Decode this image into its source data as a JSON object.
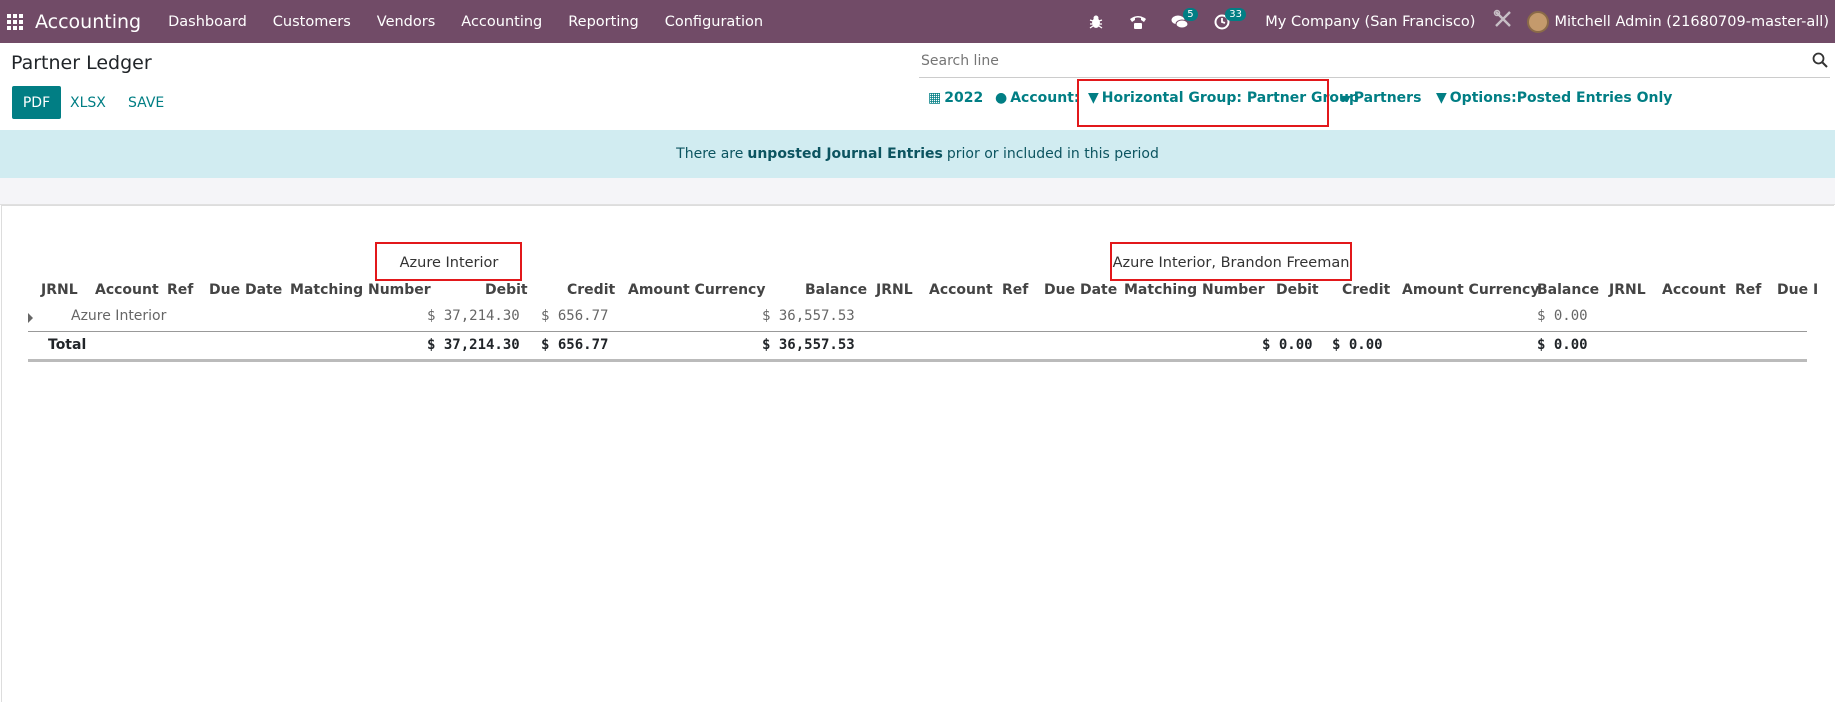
{
  "navbar": {
    "app_name": "Accounting",
    "menu": [
      "Dashboard",
      "Customers",
      "Vendors",
      "Accounting",
      "Reporting",
      "Configuration"
    ],
    "messages_badge": "5",
    "activities_badge": "33",
    "company": "My Company (San Francisco)",
    "user": "Mitchell Admin (21680709-master-all)",
    "bg_color": "#714B67"
  },
  "page": {
    "title": "Partner Ledger",
    "buttons": {
      "pdf": "PDF",
      "xlsx": "XLSX",
      "save": "SAVE"
    },
    "search_placeholder": "Search line"
  },
  "filters": {
    "date": "2022",
    "account": "Account:",
    "horizontal_group": "Horizontal Group: Partner Group",
    "partners": "Partners",
    "options": "Options:Posted Entries Only"
  },
  "alert": {
    "prefix": "There are",
    "link": "unposted Journal Entries",
    "suffix": "prior or included in this period"
  },
  "report": {
    "groups": [
      "Azure Interior",
      "Azure Interior, Brandon Freeman"
    ],
    "columns": {
      "jrnl": "JRNL",
      "account": "Account",
      "ref": "Ref",
      "due_date": "Due Date",
      "matching": "Matching Number",
      "debit": "Debit",
      "credit": "Credit",
      "amount_currency": "Amount Currency",
      "balance": "Balance",
      "due_cut": "Due I"
    },
    "rows": [
      {
        "name": "Azure Interior",
        "g1": {
          "debit": "$ 37,214.30",
          "credit": "$ 656.77",
          "balance": "$ 36,557.53"
        },
        "g2": {
          "balance": "$ 0.00"
        }
      }
    ],
    "total": {
      "label": "Total",
      "g1": {
        "debit": "$ 37,214.30",
        "credit": "$ 656.77",
        "balance": "$ 36,557.53"
      },
      "g2": {
        "debit": "$ 0.00",
        "credit": "$ 0.00",
        "balance": "$ 0.00"
      }
    }
  },
  "colors": {
    "accent": "#017e84",
    "alert_bg": "#d1ecf1",
    "highlight_box": "#e2181b"
  }
}
